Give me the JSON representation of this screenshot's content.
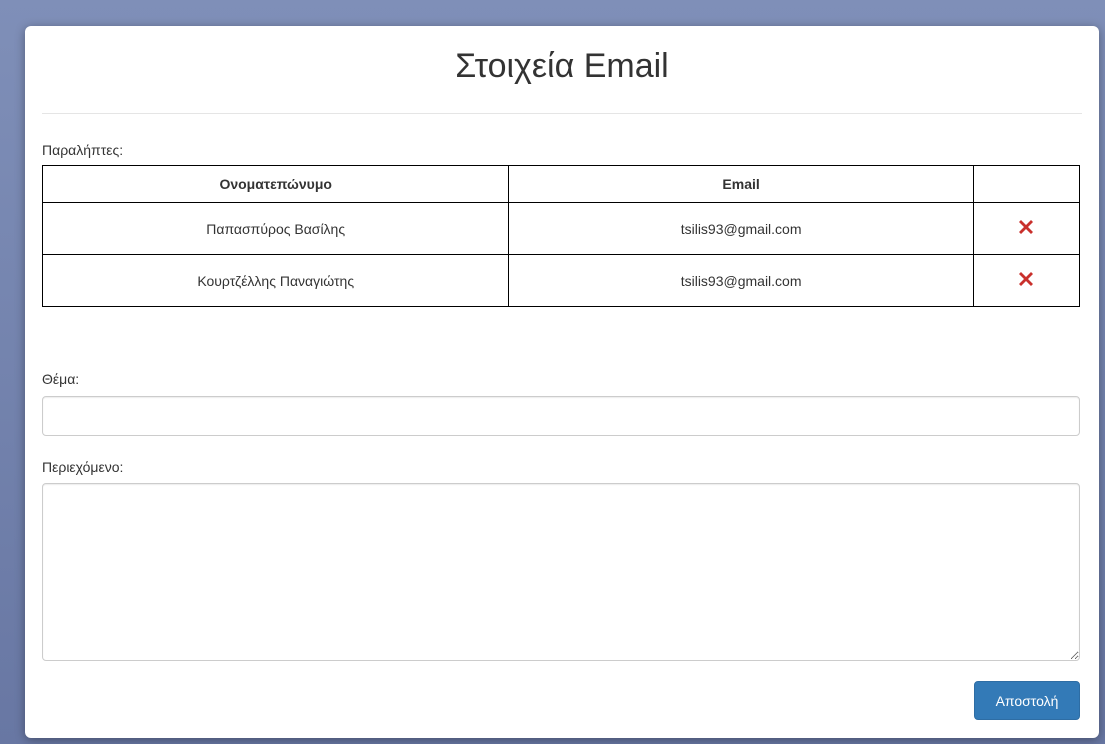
{
  "modal": {
    "title": "Στοιχεία Email",
    "recipients_label": "Παραλήπτες:",
    "table": {
      "headers": [
        "Ονοματεπώνυμο",
        "Email",
        ""
      ],
      "rows": [
        {
          "name": "Παπασπύρος Βασίλης",
          "email": "tsilis93@gmail.com",
          "action_icon": "delete-x-icon"
        },
        {
          "name": "Κουρτζέλλης Παναγιώτης",
          "email": "tsilis93@gmail.com",
          "action_icon": "delete-x-icon"
        }
      ]
    },
    "subject_label": "Θέμα:",
    "subject_value": "",
    "content_label": "Περιεχόμενο:",
    "content_value": "",
    "send_label": "Αποστολή"
  },
  "colors": {
    "backdrop": "#6c7ba6",
    "primary_button": "#337ab7",
    "delete_icon": "#c9302c"
  }
}
